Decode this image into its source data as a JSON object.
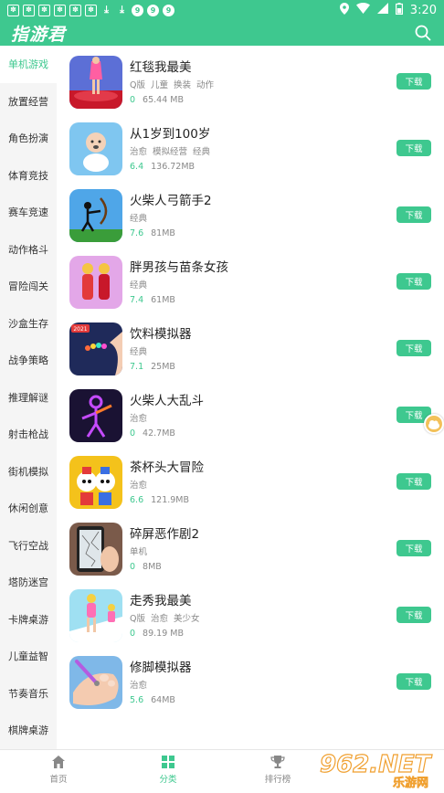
{
  "status_bar": {
    "time": "3:20"
  },
  "header": {
    "title": "指游君"
  },
  "sidebar": {
    "items": [
      "单机游戏",
      "放置经营",
      "角色扮演",
      "体育竞技",
      "赛车竞速",
      "动作格斗",
      "冒险闯关",
      "沙盒生存",
      "战争策略",
      "推理解谜",
      "射击枪战",
      "街机模拟",
      "休闲创意",
      "飞行空战",
      "塔防迷宫",
      "卡牌桌游",
      "儿童益智",
      "节奏音乐",
      "棋牌桌游"
    ]
  },
  "games": [
    {
      "name": "红毯我最美",
      "tags": "Q版 儿童 换装 动作",
      "score": "0",
      "size": "65.44 MB",
      "button": "下载"
    },
    {
      "name": "从1岁到100岁",
      "tags": "治愈 模拟经营 经典",
      "score": "6.4",
      "size": "136.72MB",
      "button": "下载"
    },
    {
      "name": "火柴人弓箭手2",
      "tags": "经典",
      "score": "7.6",
      "size": "81MB",
      "button": "下载"
    },
    {
      "name": "胖男孩与苗条女孩",
      "tags": "经典",
      "score": "7.4",
      "size": "61MB",
      "button": "下载"
    },
    {
      "name": "饮料模拟器",
      "tags": "经典",
      "score": "7.1",
      "size": "25MB",
      "button": "下载"
    },
    {
      "name": "火柴人大乱斗",
      "tags": "治愈",
      "score": "0",
      "size": "42.7MB",
      "button": "下载"
    },
    {
      "name": "茶杯头大冒险",
      "tags": "治愈",
      "score": "6.6",
      "size": "121.9MB",
      "button": "下载"
    },
    {
      "name": "碎屏恶作剧2",
      "tags": "单机",
      "score": "0",
      "size": "8MB",
      "button": "下载"
    },
    {
      "name": "走秀我最美",
      "tags": "Q版 治愈 美少女",
      "score": "0",
      "size": "89.19 MB",
      "button": "下载"
    },
    {
      "name": "修脚模拟器",
      "tags": "治愈",
      "score": "5.6",
      "size": "64MB",
      "button": "下载"
    }
  ],
  "tabbar": {
    "home": "首页",
    "category": "分类",
    "ranking": "排行榜"
  },
  "watermark": {
    "brand": "962.NET",
    "sub": "乐游网"
  },
  "icon_badge": "2021",
  "colors": {
    "accent": "#3ec88f"
  }
}
